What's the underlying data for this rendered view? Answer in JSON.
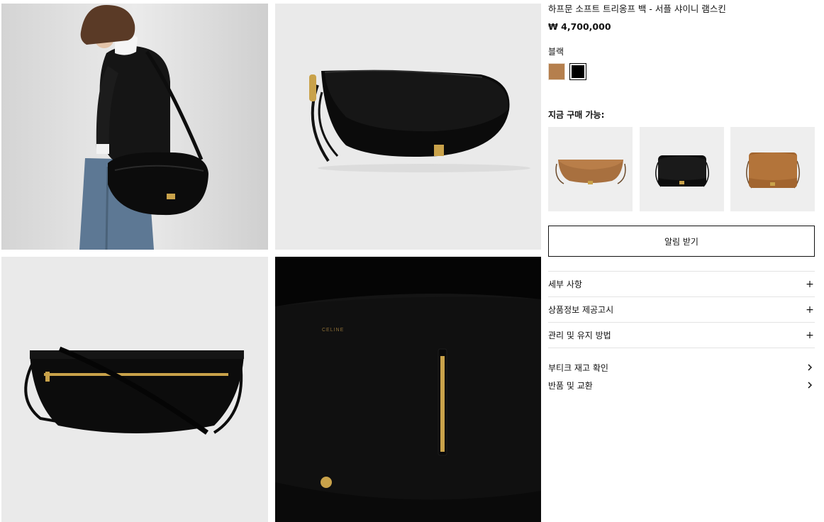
{
  "product": {
    "title": "하프문 소프트 트리옹프 백 - 서플 샤이니 램스킨",
    "price": "₩ 4,700,000",
    "selected_color": "블랙"
  },
  "colors": {
    "tan": "#b57f4d",
    "black": "#000000",
    "image_background": "#eeeeee",
    "gold_hardware": "#c9a24a"
  },
  "availability": {
    "heading": "지금 구매 가능:"
  },
  "actions": {
    "notify_label": "알림 받기"
  },
  "accordion": [
    {
      "label": "세부 사항",
      "icon": "plus-icon"
    },
    {
      "label": "상품정보 제공고시",
      "icon": "plus-icon"
    },
    {
      "label": "관리 및 유지 방법",
      "icon": "plus-icon"
    }
  ],
  "links": [
    {
      "label": "부티크 재고 확인",
      "icon": "chevron-right-icon"
    },
    {
      "label": "반품 및 교환",
      "icon": "chevron-right-icon"
    }
  ],
  "gallery_brand_stamp": "CELINE"
}
